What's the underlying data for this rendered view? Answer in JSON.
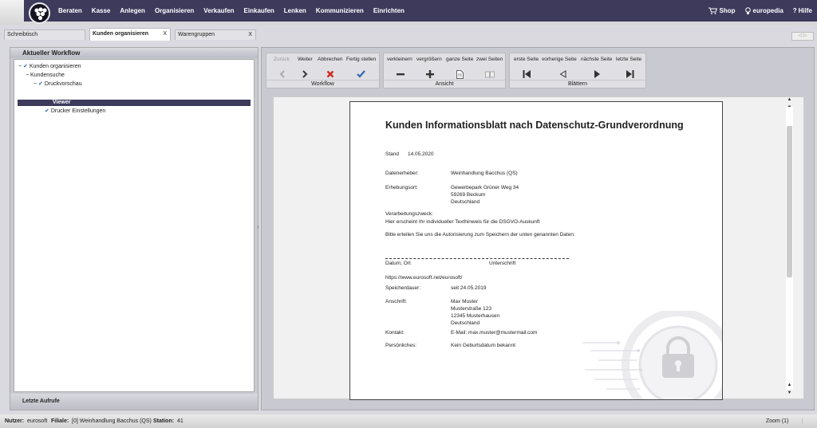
{
  "menu": {
    "items": [
      "Beraten",
      "Kasse",
      "Anlegen",
      "Organisieren",
      "Verkaufen",
      "Einkaufen",
      "Lenken",
      "Kommunizieren",
      "Einrichten"
    ],
    "right": {
      "shop": "Shop",
      "europedia": "europedia",
      "help": "Hilfe"
    }
  },
  "tabs": [
    {
      "label": "Schreibtisch",
      "close": ""
    },
    {
      "label": "Kunden organisieren",
      "close": "X"
    },
    {
      "label": "Warengruppen",
      "close": "X"
    }
  ],
  "left_panel": {
    "title": "Aktueller Workflow",
    "tree": {
      "n1": "Kunden organisieren",
      "n2": "Kundensuche",
      "n3": "Druckvorschau",
      "n4": "Viewer",
      "n5": "Drucker Einstellungen"
    },
    "footer": "Letzte Aufrufe"
  },
  "toolbar": {
    "workflow": {
      "name": "Workflow",
      "back": "Zurück",
      "next": "Weiter",
      "cancel": "Abbrechen",
      "done": "Fertig stellen"
    },
    "ansicht": {
      "name": "Ansicht",
      "smaller": "verkleinern",
      "bigger": "vergrößern",
      "full": "ganze Seite",
      "two": "zwei Seiten"
    },
    "blaettern": {
      "name": "Blättern",
      "first": "erste Seite",
      "prev": "vorherige Seite",
      "next": "nächste Seite",
      "last": "letzte Seite"
    }
  },
  "document": {
    "title": "Kunden Informationsblatt nach Datenschutz-Grundverordnung",
    "stand_label": "Stand",
    "stand_value": "14.05.2020",
    "datenerheber_label": "Datenerheber:",
    "datenerheber_value": "Weinhandlung Bacchus (QS)",
    "erhebungsort_label": "Erhebungsort:",
    "erhebungsort_lines": [
      "Gewerbepark Grüner Weg 34",
      "59269 Beckum",
      "Deutschland"
    ],
    "zweck_label": "Verarbeitungszweck:",
    "zweck_text": "Hier erscheint Ihr individueller Texthinweis für die DSGVO-Auskunft",
    "bitte_text": "Bitte erteilen Sie uns die Autorisierung zum Speichern der unten genannten Daten:",
    "datum_ort": "Datum, Ort",
    "unterschrift": "Unterschrift",
    "url": "https://www.eurosoft.net/eurosoft/",
    "speicher_label": "Speicherdauer:",
    "speicher_value": "seit 24.05.2019",
    "anschrift_label": "Anschrift:",
    "anschrift_lines": [
      "Max Muster",
      "Musterstraße 123",
      "12345 Musterhausen",
      "Deutschland"
    ],
    "kontakt_label": "Kontakt:",
    "kontakt_value": "E-Mail: max.muster@mustermail.com",
    "persoenlich_label": "Persönliches:",
    "persoenlich_value": "Kein Geburtsdatum bekannt"
  },
  "status": {
    "nutzer_label": "Nutzer:",
    "nutzer": "eurosoft",
    "filiale_label": "Filiale:",
    "filiale": "[0] Weinhandlung Bacchus (QS)",
    "station_label": "Station:",
    "station": "41",
    "zoom": "Zoom (1)"
  },
  "colors": {
    "menubar": "#3d3a5c",
    "accent_blue": "#2f68b0",
    "cancel_red": "#cc2a20"
  }
}
